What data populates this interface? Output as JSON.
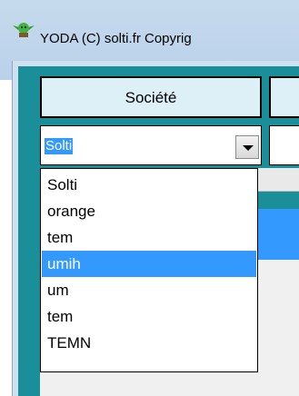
{
  "window": {
    "title": "YODA  (C) solti.fr Copyrig",
    "icon": "yoda-icon"
  },
  "form": {
    "column_header": "Société",
    "combo": {
      "value": "Solti",
      "arrow_icon": "chevron-down-icon"
    },
    "dropdown": {
      "items": [
        "Solti",
        "orange",
        "tem",
        "umih",
        "um",
        "tem",
        "TEMN"
      ],
      "selected_index": 3
    }
  },
  "colors": {
    "selection": "#3399ff",
    "client_background": "#1a8f99",
    "header_background": "#ddeff7"
  }
}
